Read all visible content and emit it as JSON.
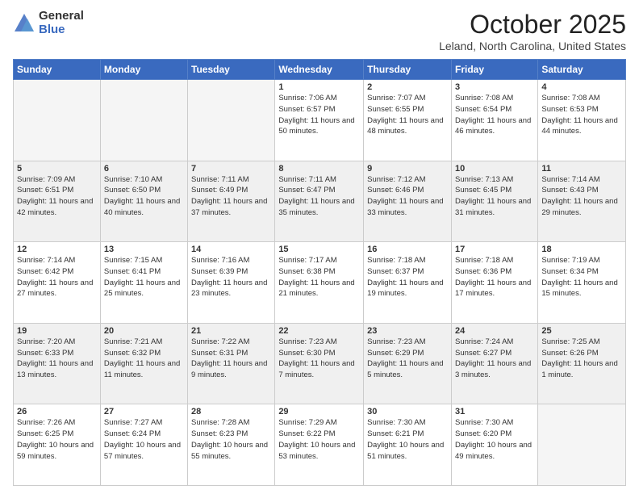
{
  "logo": {
    "general": "General",
    "blue": "Blue"
  },
  "title": "October 2025",
  "location": "Leland, North Carolina, United States",
  "days_of_week": [
    "Sunday",
    "Monday",
    "Tuesday",
    "Wednesday",
    "Thursday",
    "Friday",
    "Saturday"
  ],
  "weeks": [
    [
      {
        "num": "",
        "info": ""
      },
      {
        "num": "",
        "info": ""
      },
      {
        "num": "",
        "info": ""
      },
      {
        "num": "1",
        "info": "Sunrise: 7:06 AM\nSunset: 6:57 PM\nDaylight: 11 hours and 50 minutes."
      },
      {
        "num": "2",
        "info": "Sunrise: 7:07 AM\nSunset: 6:55 PM\nDaylight: 11 hours and 48 minutes."
      },
      {
        "num": "3",
        "info": "Sunrise: 7:08 AM\nSunset: 6:54 PM\nDaylight: 11 hours and 46 minutes."
      },
      {
        "num": "4",
        "info": "Sunrise: 7:08 AM\nSunset: 6:53 PM\nDaylight: 11 hours and 44 minutes."
      }
    ],
    [
      {
        "num": "5",
        "info": "Sunrise: 7:09 AM\nSunset: 6:51 PM\nDaylight: 11 hours and 42 minutes."
      },
      {
        "num": "6",
        "info": "Sunrise: 7:10 AM\nSunset: 6:50 PM\nDaylight: 11 hours and 40 minutes."
      },
      {
        "num": "7",
        "info": "Sunrise: 7:11 AM\nSunset: 6:49 PM\nDaylight: 11 hours and 37 minutes."
      },
      {
        "num": "8",
        "info": "Sunrise: 7:11 AM\nSunset: 6:47 PM\nDaylight: 11 hours and 35 minutes."
      },
      {
        "num": "9",
        "info": "Sunrise: 7:12 AM\nSunset: 6:46 PM\nDaylight: 11 hours and 33 minutes."
      },
      {
        "num": "10",
        "info": "Sunrise: 7:13 AM\nSunset: 6:45 PM\nDaylight: 11 hours and 31 minutes."
      },
      {
        "num": "11",
        "info": "Sunrise: 7:14 AM\nSunset: 6:43 PM\nDaylight: 11 hours and 29 minutes."
      }
    ],
    [
      {
        "num": "12",
        "info": "Sunrise: 7:14 AM\nSunset: 6:42 PM\nDaylight: 11 hours and 27 minutes."
      },
      {
        "num": "13",
        "info": "Sunrise: 7:15 AM\nSunset: 6:41 PM\nDaylight: 11 hours and 25 minutes."
      },
      {
        "num": "14",
        "info": "Sunrise: 7:16 AM\nSunset: 6:39 PM\nDaylight: 11 hours and 23 minutes."
      },
      {
        "num": "15",
        "info": "Sunrise: 7:17 AM\nSunset: 6:38 PM\nDaylight: 11 hours and 21 minutes."
      },
      {
        "num": "16",
        "info": "Sunrise: 7:18 AM\nSunset: 6:37 PM\nDaylight: 11 hours and 19 minutes."
      },
      {
        "num": "17",
        "info": "Sunrise: 7:18 AM\nSunset: 6:36 PM\nDaylight: 11 hours and 17 minutes."
      },
      {
        "num": "18",
        "info": "Sunrise: 7:19 AM\nSunset: 6:34 PM\nDaylight: 11 hours and 15 minutes."
      }
    ],
    [
      {
        "num": "19",
        "info": "Sunrise: 7:20 AM\nSunset: 6:33 PM\nDaylight: 11 hours and 13 minutes."
      },
      {
        "num": "20",
        "info": "Sunrise: 7:21 AM\nSunset: 6:32 PM\nDaylight: 11 hours and 11 minutes."
      },
      {
        "num": "21",
        "info": "Sunrise: 7:22 AM\nSunset: 6:31 PM\nDaylight: 11 hours and 9 minutes."
      },
      {
        "num": "22",
        "info": "Sunrise: 7:23 AM\nSunset: 6:30 PM\nDaylight: 11 hours and 7 minutes."
      },
      {
        "num": "23",
        "info": "Sunrise: 7:23 AM\nSunset: 6:29 PM\nDaylight: 11 hours and 5 minutes."
      },
      {
        "num": "24",
        "info": "Sunrise: 7:24 AM\nSunset: 6:27 PM\nDaylight: 11 hours and 3 minutes."
      },
      {
        "num": "25",
        "info": "Sunrise: 7:25 AM\nSunset: 6:26 PM\nDaylight: 11 hours and 1 minute."
      }
    ],
    [
      {
        "num": "26",
        "info": "Sunrise: 7:26 AM\nSunset: 6:25 PM\nDaylight: 10 hours and 59 minutes."
      },
      {
        "num": "27",
        "info": "Sunrise: 7:27 AM\nSunset: 6:24 PM\nDaylight: 10 hours and 57 minutes."
      },
      {
        "num": "28",
        "info": "Sunrise: 7:28 AM\nSunset: 6:23 PM\nDaylight: 10 hours and 55 minutes."
      },
      {
        "num": "29",
        "info": "Sunrise: 7:29 AM\nSunset: 6:22 PM\nDaylight: 10 hours and 53 minutes."
      },
      {
        "num": "30",
        "info": "Sunrise: 7:30 AM\nSunset: 6:21 PM\nDaylight: 10 hours and 51 minutes."
      },
      {
        "num": "31",
        "info": "Sunrise: 7:30 AM\nSunset: 6:20 PM\nDaylight: 10 hours and 49 minutes."
      },
      {
        "num": "",
        "info": ""
      }
    ]
  ]
}
